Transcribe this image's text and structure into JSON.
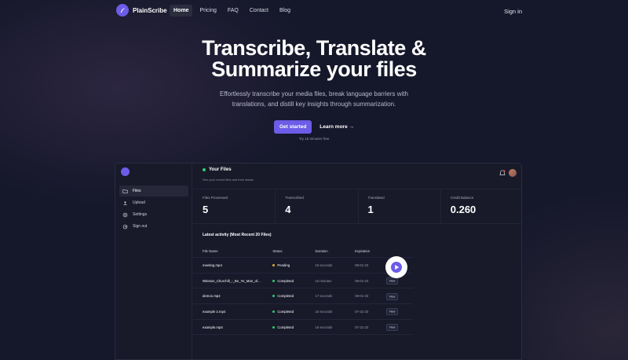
{
  "nav": {
    "brand": "PlainScribe",
    "links": [
      {
        "label": "Home"
      },
      {
        "label": "Pricing"
      },
      {
        "label": "FAQ"
      },
      {
        "label": "Contact"
      },
      {
        "label": "Blog"
      }
    ],
    "signin": "Sign in"
  },
  "hero": {
    "title_line1": "Transcribe, Translate &",
    "title_line2": "Summarize your files",
    "subtitle": "Effortlessly transcribe your media files, break language barriers with translations, and distill key insights through summarization.",
    "cta_primary": "Get started",
    "cta_secondary": "Learn more →",
    "note": "Try 15 minutes free"
  },
  "colors": {
    "accent": "#6c5ce7",
    "bg": "#15172a",
    "pending": "#e0b020",
    "completed": "#2ecc71"
  },
  "app": {
    "sidebar": [
      {
        "label": "Files",
        "icon": "folder-icon"
      },
      {
        "label": "Upload",
        "icon": "upload-icon"
      },
      {
        "label": "Settings",
        "icon": "gear-icon"
      },
      {
        "label": "Sign out",
        "icon": "signout-icon"
      }
    ],
    "header": {
      "title": "Your Files",
      "subtitle": "See your recent files and their status"
    },
    "stats": [
      {
        "label": "Files Processed",
        "value": "5"
      },
      {
        "label": "Transcribed",
        "value": "4"
      },
      {
        "label": "Translated",
        "value": "1"
      },
      {
        "label": "Credit Balance",
        "value": "0.260"
      }
    ],
    "activity_title": "Latest activity (Most Recent 20 Files)",
    "columns": {
      "name": "File Name",
      "status": "Status",
      "duration": "Duration",
      "expiration": "Expiration"
    },
    "rows": [
      {
        "name": "meeting.mp4",
        "status": "Pending",
        "duration": "16 seconds",
        "expiration": "08-01-23",
        "view": ""
      },
      {
        "name": "Winston_Churchill_-_Be_Ye_Man_of...",
        "status": "Completed",
        "duration": "10 minutes",
        "expiration": "08-01-23",
        "view": "View"
      },
      {
        "name": "demo1.mp4",
        "status": "Completed",
        "duration": "17 seconds",
        "expiration": "08-01-23",
        "view": "View"
      },
      {
        "name": "example 2.mp4",
        "status": "Completed",
        "duration": "16 seconds",
        "expiration": "07-31-23",
        "view": "View"
      },
      {
        "name": "example.mp4",
        "status": "Completed",
        "duration": "16 seconds",
        "expiration": "07-31-23",
        "view": "View"
      }
    ]
  }
}
